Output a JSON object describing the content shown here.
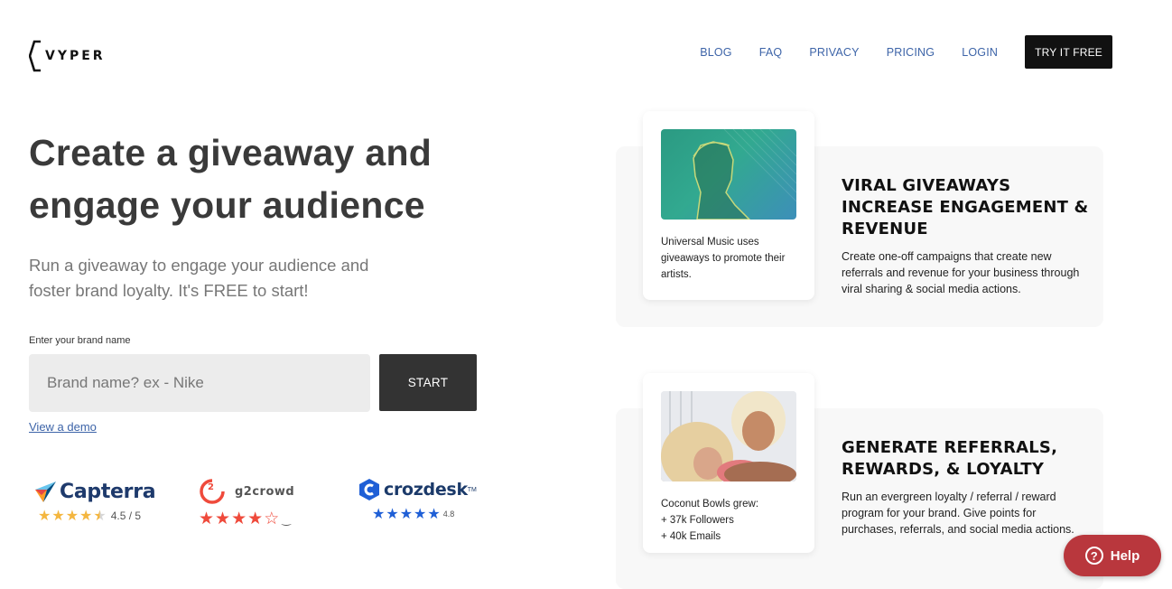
{
  "header": {
    "logo_text": "VYPER",
    "nav": [
      {
        "label": "BLOG"
      },
      {
        "label": "FAQ"
      },
      {
        "label": "PRIVACY"
      },
      {
        "label": "PRICING"
      },
      {
        "label": "LOGIN"
      }
    ],
    "cta_label": "TRY IT FREE"
  },
  "hero": {
    "title_line1": "Create a giveaway and",
    "title_line2": "engage your audience",
    "subtitle": "Run a giveaway to engage your audience and foster brand loyalty. It's FREE to start!",
    "input_label": "Enter your brand name",
    "input_placeholder": "Brand name? ex - Nike",
    "start_label": "START",
    "demo_link": "View a demo"
  },
  "ratings": [
    {
      "brand": "Capterra",
      "score": "4.5 / 5",
      "stars": 4.5,
      "star_color": "#f4b63f",
      "icon": "capterra-logo-icon"
    },
    {
      "brand": "g2crowd",
      "score": "",
      "stars": 4.5,
      "star_color": "#ef4a3b",
      "icon": "g2-logo-icon"
    },
    {
      "brand": "crozdesk",
      "score": "4.8",
      "stars": 5,
      "star_color": "#1f5fd6",
      "icon": "crozdesk-logo-icon"
    }
  ],
  "features": [
    {
      "caption": "Universal Music uses giveaways to promote their artists.",
      "title": "VIRAL GIVEAWAYS INCREASE ENGAGEMENT & REVENUE",
      "description": "Create one-off campaigns that create new referrals and revenue for your business through viral sharing & social media actions."
    },
    {
      "caption": "Coconut Bowls grew:\n+ 37k Followers\n+ 40k Emails",
      "title": "GENERATE REFERRALS, REWARDS, & LOYALTY",
      "description": "Run an evergreen loyalty / referral / reward program for your brand. Give points for purchases, referrals, and social media actions."
    }
  ],
  "help": {
    "label": "Help"
  },
  "colors": {
    "nav_link": "#3d64a8",
    "help_button": "#b9373d",
    "dark_button": "#333333"
  }
}
